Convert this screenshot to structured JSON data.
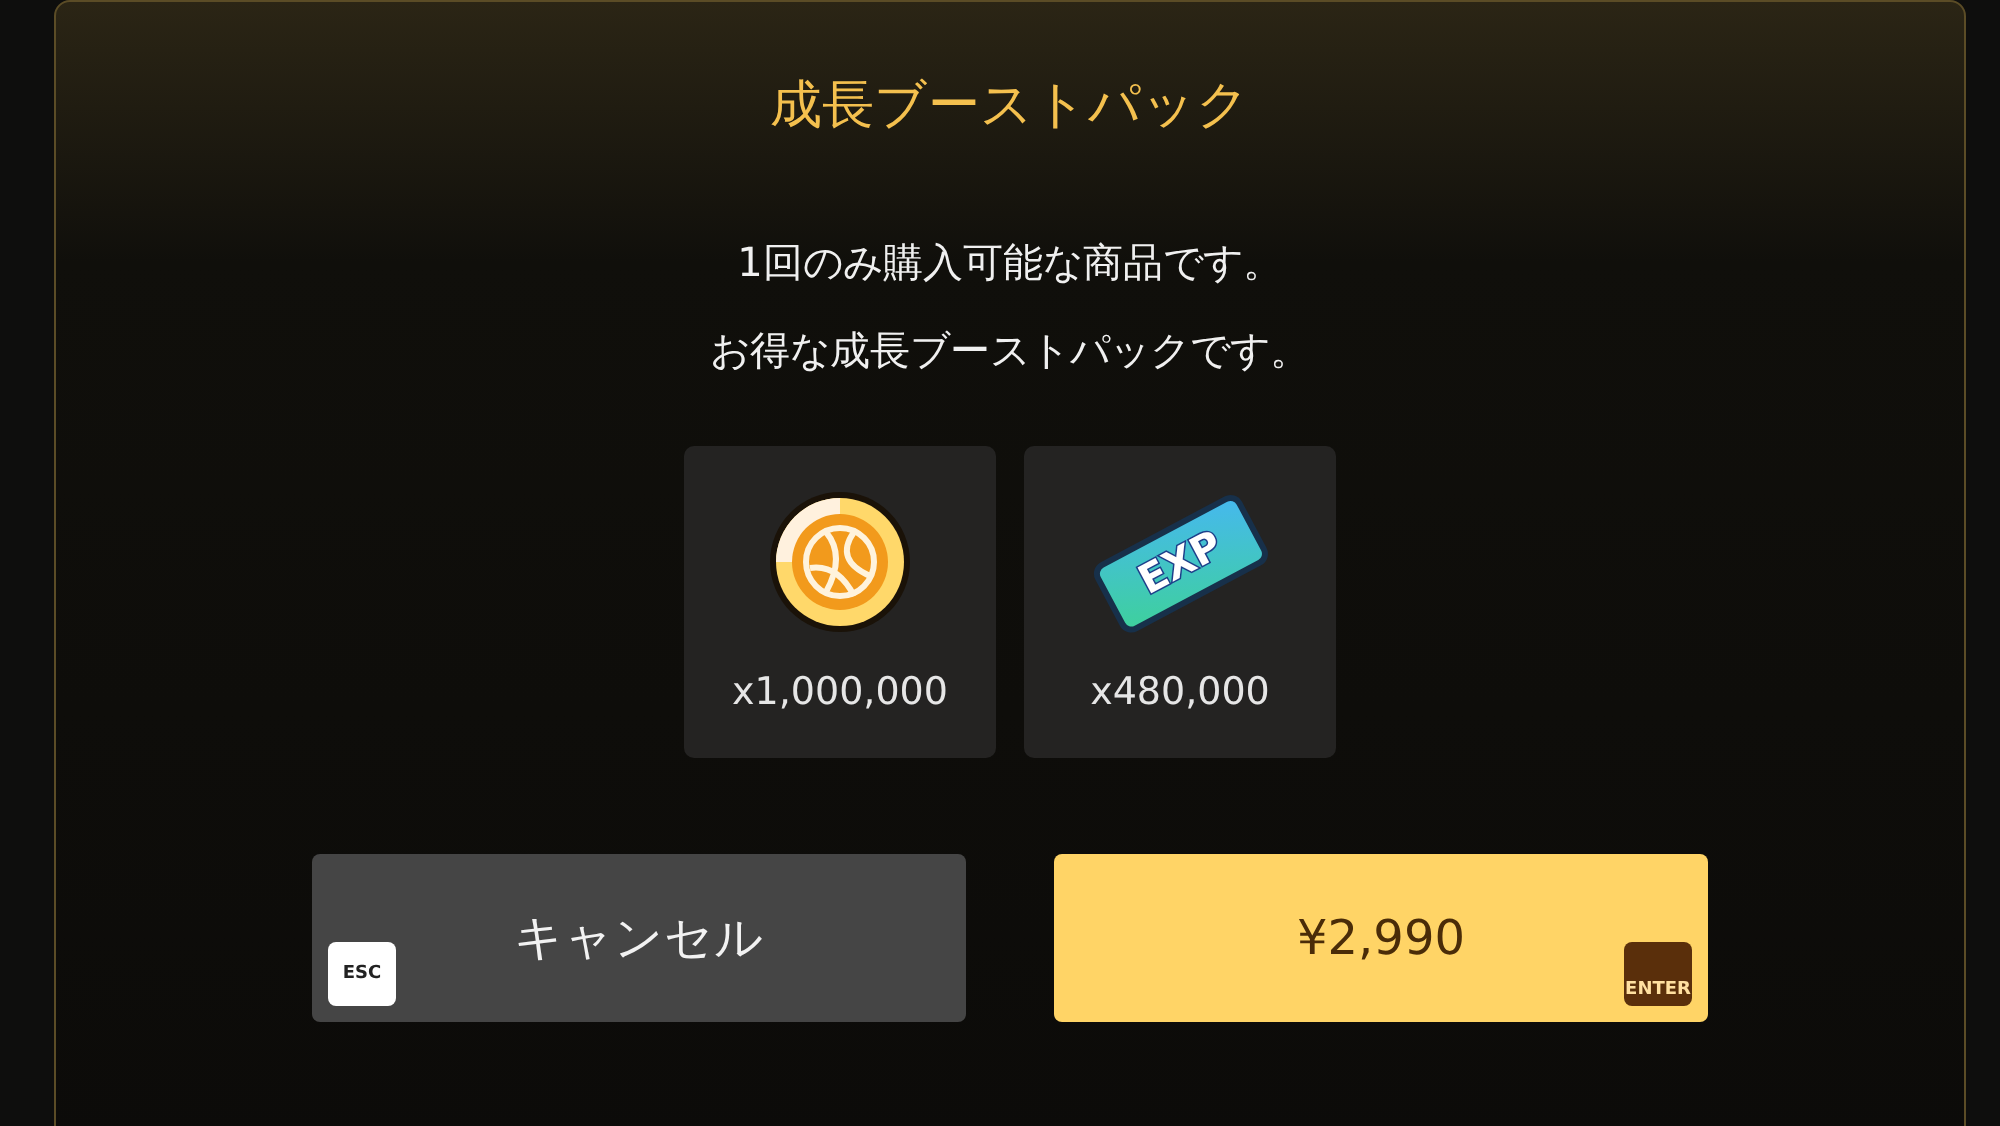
{
  "dialog": {
    "title": "成長ブーストパック",
    "message": [
      "1回のみ購入可能な商品です。",
      "お得な成長ブーストパックです。"
    ],
    "items": [
      {
        "kind": "coin",
        "quantity": "x1,000,000"
      },
      {
        "kind": "ticket",
        "icon_text": "EXP",
        "quantity": "x480,000"
      }
    ],
    "buttons": [
      {
        "kind": "cancel",
        "label": "キャンセル",
        "key": "ESC"
      },
      {
        "kind": "buy",
        "label": "¥2,990",
        "key": "ENTER"
      }
    ]
  }
}
